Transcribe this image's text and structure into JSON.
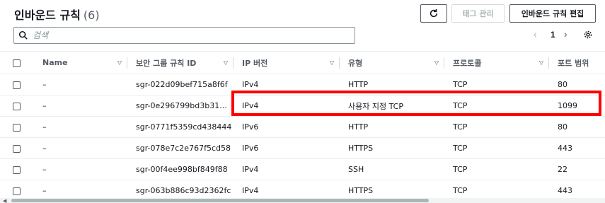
{
  "header": {
    "title": "인바운드 규칙",
    "count": "(6)",
    "tag_manage_label": "태그 관리",
    "edit_rules_label": "인바운드 규칙 편집"
  },
  "search": {
    "placeholder": "검색"
  },
  "pagination": {
    "current_page": "1",
    "prev": "‹",
    "next": "›"
  },
  "table": {
    "columns": [
      "Name",
      "보안 그룹 규칙 ID",
      "IP 버전",
      "유형",
      "프로토콜",
      "포트 범위"
    ],
    "rows": [
      [
        "–",
        "sgr-022d09bef715a8f6f",
        "IPv4",
        "HTTP",
        "TCP",
        "80"
      ],
      [
        "–",
        "sgr-0e296799bd3b31...",
        "IPv4",
        "사용자 지정 TCP",
        "TCP",
        "1099"
      ],
      [
        "–",
        "sgr-0771f5359cd438444",
        "IPv6",
        "HTTP",
        "TCP",
        "80"
      ],
      [
        "–",
        "sgr-078e7c2e767f5cd58",
        "IPv6",
        "HTTPS",
        "TCP",
        "443"
      ],
      [
        "–",
        "sgr-00f4ee998bf849f88",
        "IPv4",
        "SSH",
        "TCP",
        "22"
      ],
      [
        "–",
        "sgr-063b886c93d2362fc",
        "IPv4",
        "HTTPS",
        "TCP",
        "443"
      ]
    ]
  },
  "colors": {
    "highlight": "#ff0000",
    "text": "#16191f",
    "muted": "#545b64"
  }
}
